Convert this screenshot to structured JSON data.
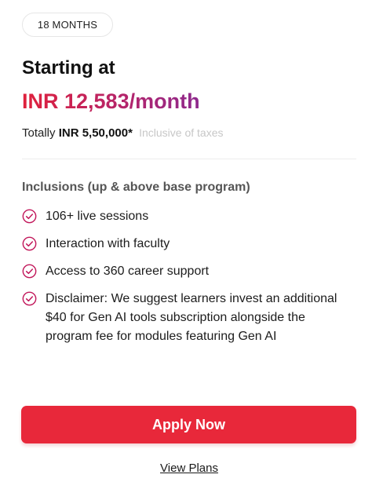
{
  "plan": {
    "duration": "18 MONTHS",
    "starting_label": "Starting at",
    "monthly_price": "INR 12,583/month",
    "total_prefix": "Totally",
    "total_amount": "INR 5,50,000*",
    "tax_note": "Inclusive of taxes"
  },
  "inclusions": {
    "title": "Inclusions (up & above base program)",
    "items": [
      {
        "text": "106+ live sessions",
        "icon": "check-circle-icon"
      },
      {
        "text": "Interaction with faculty",
        "icon": "check-circle-icon"
      },
      {
        "text": "Access to 360 career support",
        "icon": "check-circle-icon"
      },
      {
        "text": "Disclaimer: We suggest learners invest an additional $40 for Gen AI tools subscription alongside the program fee for modules featuring Gen AI",
        "icon": "check-circle-icon"
      }
    ]
  },
  "actions": {
    "apply_label": "Apply Now",
    "view_plans_label": "View Plans"
  },
  "colors": {
    "accent_red": "#e8283a",
    "price_gradient_start": "#e0213c",
    "price_gradient_end": "#8e2a8e",
    "check_icon": "#c2185b"
  }
}
